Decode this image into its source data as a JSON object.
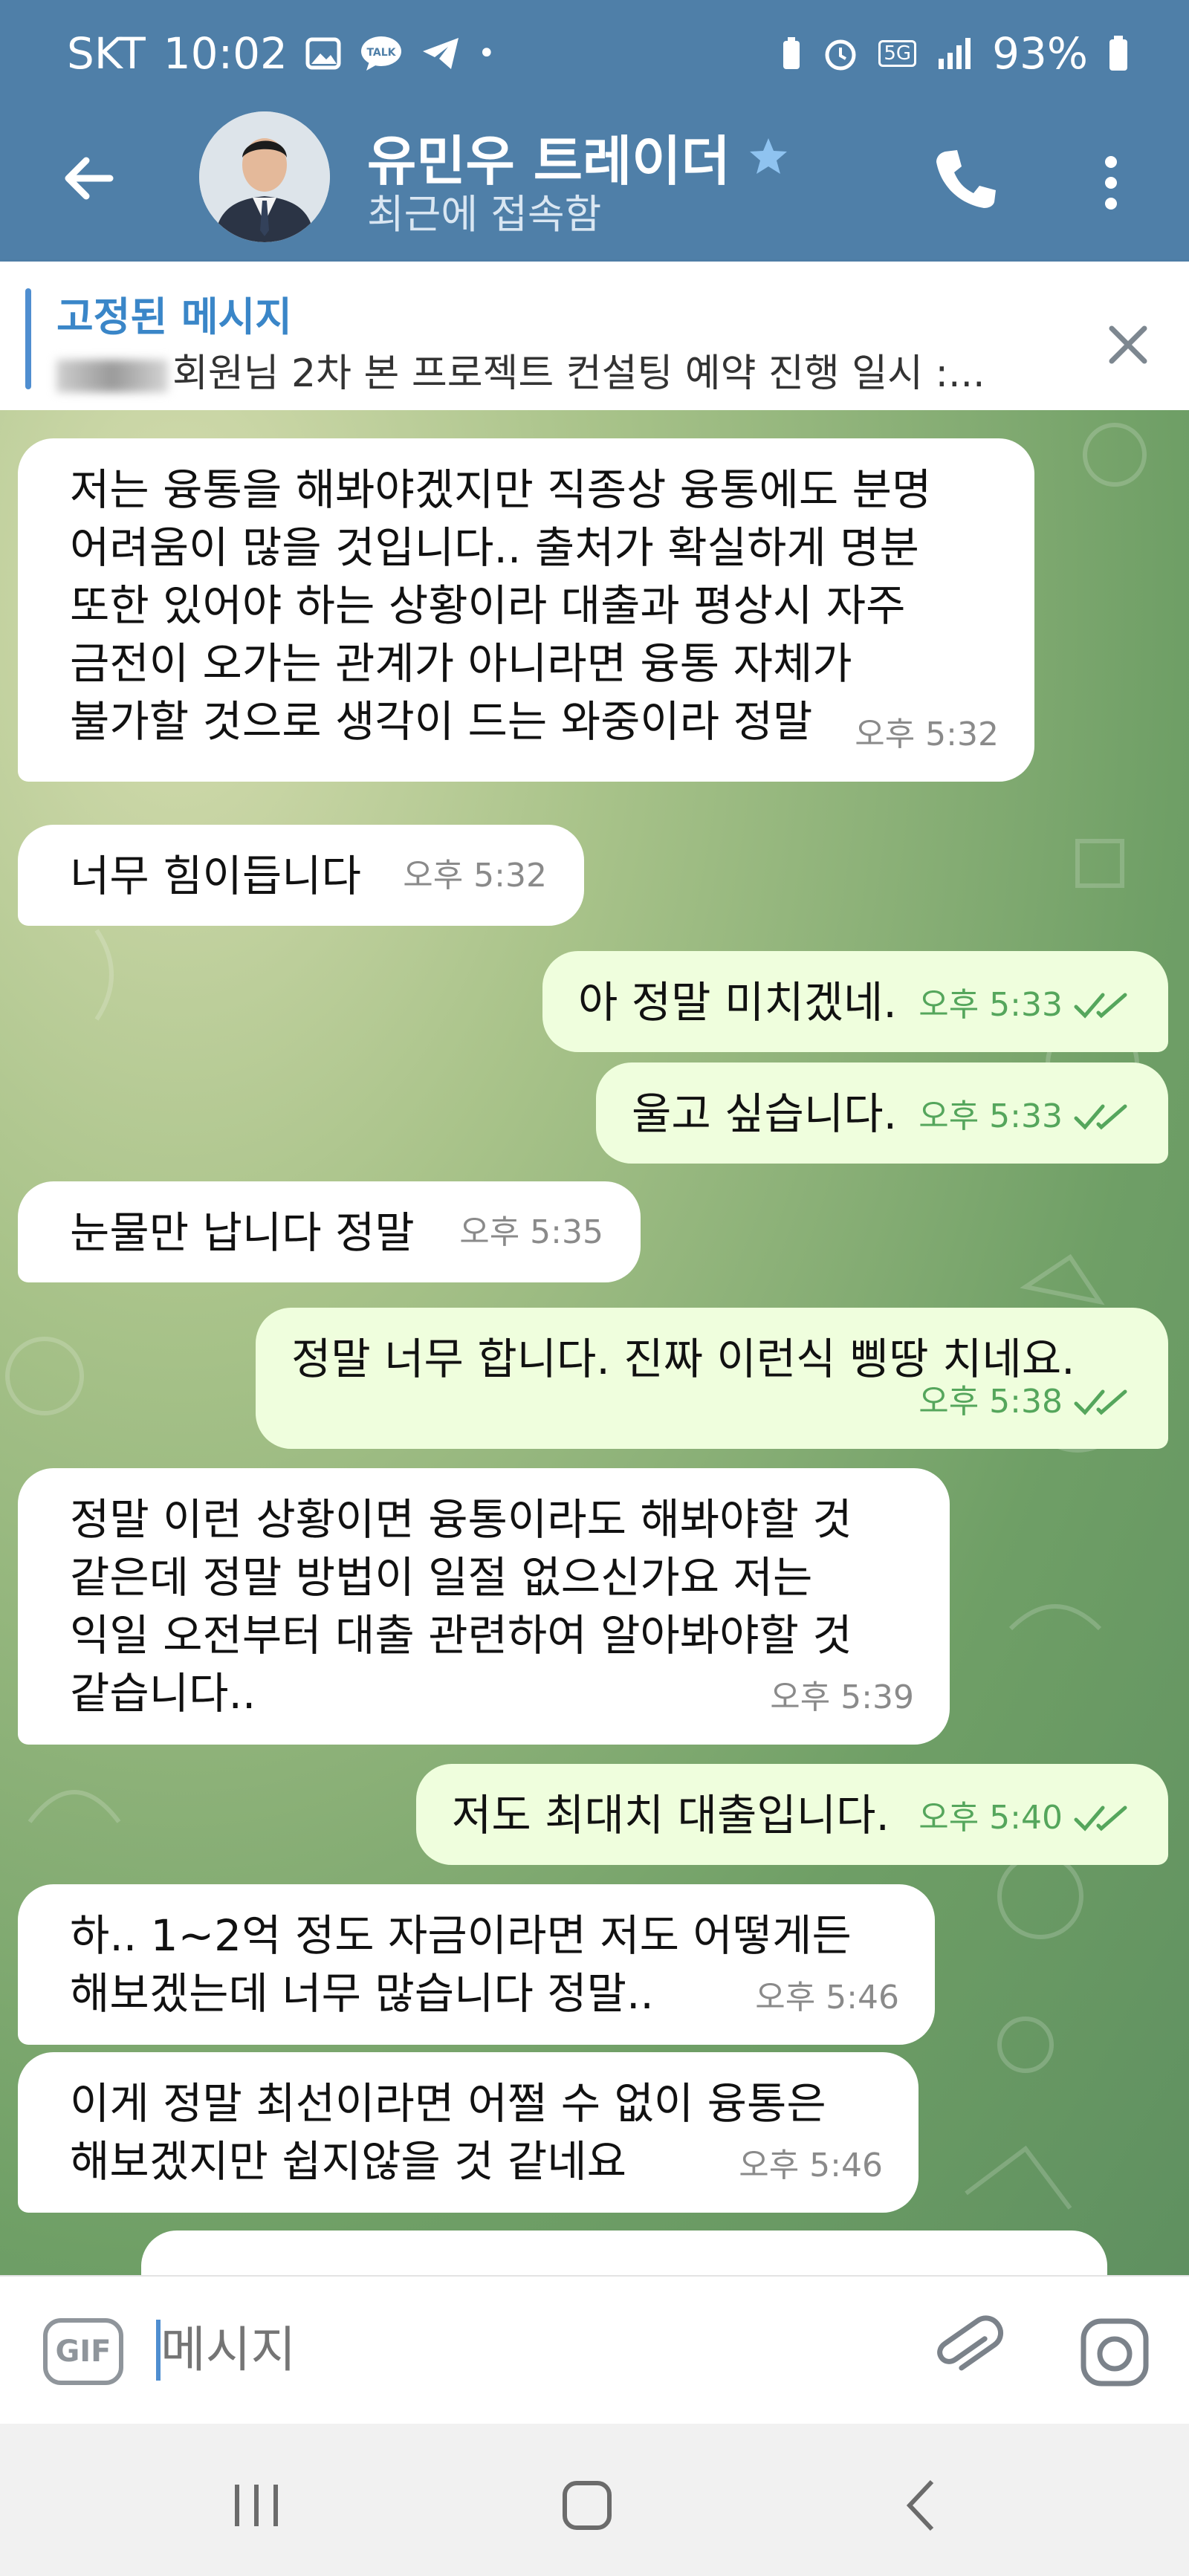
{
  "status_bar": {
    "carrier": "SKT",
    "time": "10:02",
    "battery": "93%",
    "network": "5G"
  },
  "header": {
    "name": "유민우 트레이더",
    "subtitle": "최근에 접속함"
  },
  "pinned": {
    "title": "고정된 메시지",
    "text": "회원님   2차 본 프로젝트 컨설팅 예약  진행 일시 :..."
  },
  "messages": [
    {
      "dir": "in",
      "text": "저는 융통을 해봐야겠지만 직종상 융통에도 분명\n어려움이 많을 것입니다.. 출처가 확실하게 명분\n또한 있어야 하는 상황이라 대출과 평상시 자주\n금전이 오가는 관계가 아니라면 융통 자체가\n불가할 것으로 생각이 드는 와중이라 정말",
      "time": "오후 5:32"
    },
    {
      "dir": "in",
      "text": "너무 힘이듭니다",
      "time": "오후 5:32"
    },
    {
      "dir": "out",
      "text": "아 정말 미치겠네.",
      "time": "오후 5:33"
    },
    {
      "dir": "out",
      "text": "울고 싶습니다.",
      "time": "오후 5:33"
    },
    {
      "dir": "in",
      "text": "눈물만 납니다 정말",
      "time": "오후 5:35"
    },
    {
      "dir": "out",
      "text": "정말 너무 합니다. 진짜 이런식 삥땅 치네요.",
      "time": "오후 5:38"
    },
    {
      "dir": "in",
      "text": "정말 이런 상황이면 융통이라도 해봐야할 것\n같은데 정말 방법이 일절 없으신가요 저는\n익일 오전부터 대출 관련하여 알아봐야할 것\n같습니다..",
      "time": "오후 5:39"
    },
    {
      "dir": "out",
      "text": "저도 최대치 대출입니다.",
      "time": "오후 5:40"
    },
    {
      "dir": "in",
      "text": "하.. 1~2억 정도 자금이라면 저도 어떻게든\n해보겠는데 너무 많습니다 정말..",
      "time": "오후 5:46"
    },
    {
      "dir": "in",
      "text": "이게 정말 최선이라면 어쩔 수 없이 융통은\n해보겠지만 쉽지않을 것 같네요",
      "time": "오후 5:46"
    }
  ],
  "input": {
    "placeholder": "메시지",
    "gif_label": "GIF"
  },
  "colors": {
    "header": "#4f7fa8",
    "outgoing_bubble": "#effedd",
    "incoming_bubble": "#ffffff",
    "read_ticks": "#55a65c"
  }
}
